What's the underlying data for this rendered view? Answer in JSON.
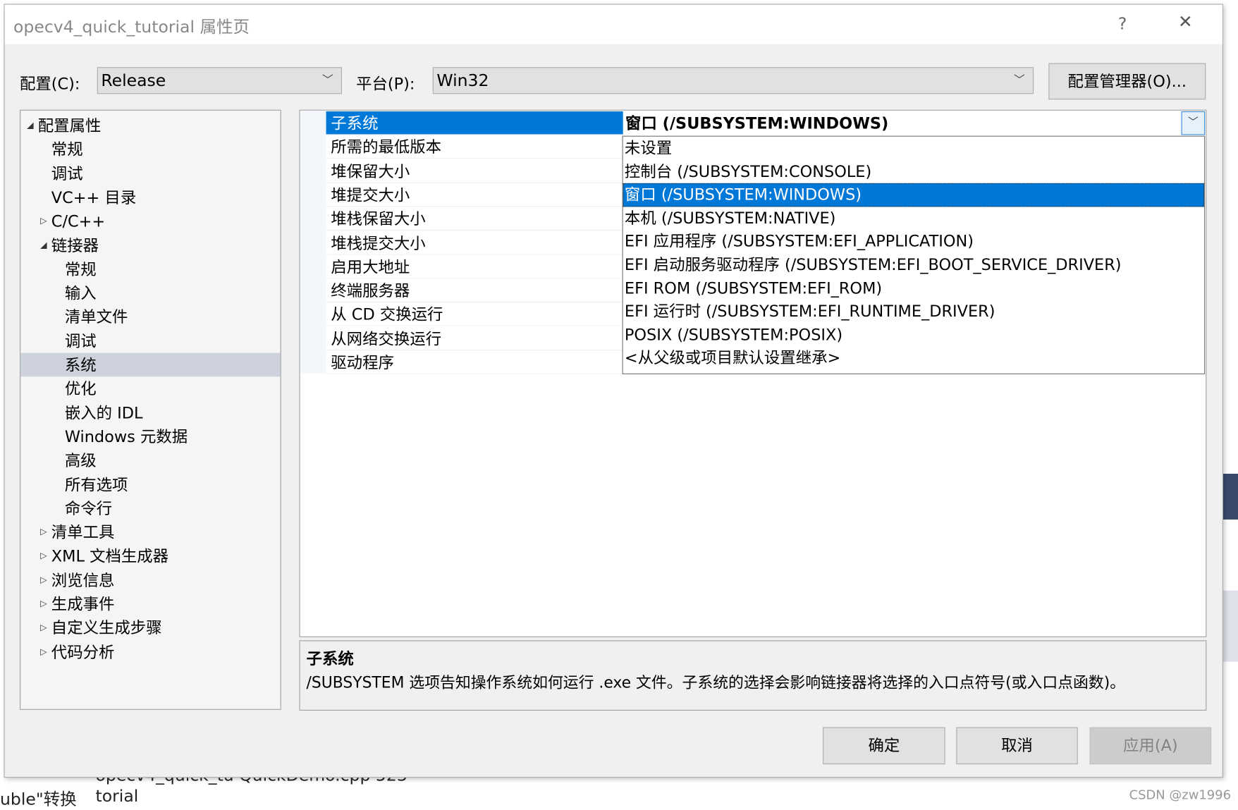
{
  "window": {
    "title": "opecv4_quick_tutorial 属性页",
    "help": "?",
    "close": "✕"
  },
  "toolbar": {
    "config_label": "配置(C):",
    "config_value": "Release",
    "platform_label": "平台(P):",
    "platform_value": "Win32",
    "config_manager": "配置管理器(O)..."
  },
  "tree": [
    {
      "label": "配置属性",
      "level": 0,
      "expander": "open"
    },
    {
      "label": "常规",
      "level": 1
    },
    {
      "label": "调试",
      "level": 1
    },
    {
      "label": "VC++ 目录",
      "level": 1
    },
    {
      "label": "C/C++",
      "level": 1,
      "expander": "closed"
    },
    {
      "label": "链接器",
      "level": 1,
      "expander": "open"
    },
    {
      "label": "常规",
      "level": 2
    },
    {
      "label": "输入",
      "level": 2
    },
    {
      "label": "清单文件",
      "level": 2
    },
    {
      "label": "调试",
      "level": 2
    },
    {
      "label": "系统",
      "level": 2,
      "selected": true
    },
    {
      "label": "优化",
      "level": 2
    },
    {
      "label": "嵌入的 IDL",
      "level": 2
    },
    {
      "label": "Windows 元数据",
      "level": 2
    },
    {
      "label": "高级",
      "level": 2
    },
    {
      "label": "所有选项",
      "level": 2
    },
    {
      "label": "命令行",
      "level": 2
    },
    {
      "label": "清单工具",
      "level": 1,
      "expander": "closed"
    },
    {
      "label": "XML 文档生成器",
      "level": 1,
      "expander": "closed"
    },
    {
      "label": "浏览信息",
      "level": 1,
      "expander": "closed"
    },
    {
      "label": "生成事件",
      "level": 1,
      "expander": "closed"
    },
    {
      "label": "自定义生成步骤",
      "level": 1,
      "expander": "closed"
    },
    {
      "label": "代码分析",
      "level": 1,
      "expander": "closed"
    }
  ],
  "properties": [
    "子系统",
    "所需的最低版本",
    "堆保留大小",
    "堆提交大小",
    "堆栈保留大小",
    "堆栈提交大小",
    "启用大地址",
    "终端服务器",
    "从 CD 交换运行",
    "从网络交换运行",
    "驱动程序"
  ],
  "selected_value": "窗口 (/SUBSYSTEM:WINDOWS)",
  "dropdown_options": [
    "未设置",
    "控制台 (/SUBSYSTEM:CONSOLE)",
    "窗口 (/SUBSYSTEM:WINDOWS)",
    "本机 (/SUBSYSTEM:NATIVE)",
    "EFI 应用程序 (/SUBSYSTEM:EFI_APPLICATION)",
    "EFI 启动服务驱动程序 (/SUBSYSTEM:EFI_BOOT_SERVICE_DRIVER)",
    "EFI ROM (/SUBSYSTEM:EFI_ROM)",
    "EFI 运行时 (/SUBSYSTEM:EFI_RUNTIME_DRIVER)",
    "POSIX (/SUBSYSTEM:POSIX)",
    "<从父级或项目默认设置继承>"
  ],
  "dropdown_selected_index": 2,
  "description": {
    "title": "子系统",
    "text": "/SUBSYSTEM 选项告知操作系统如何运行 .exe 文件。子系统的选择会影响链接器将选择的入口点符号(或入口点函数)。"
  },
  "buttons": {
    "ok": "确定",
    "cancel": "取消",
    "apply": "应用(A)"
  },
  "background": {
    "line1": "opecv4_quick_tu QuickDemo.cpp   523",
    "line2a": "uble\"转换",
    "line2b": "torial"
  },
  "watermark": "CSDN @zw1996",
  "colors": {
    "selection": "#0078d7",
    "tree_selection": "#cdd2dd",
    "dialog_bg": "#f0f0f0"
  }
}
